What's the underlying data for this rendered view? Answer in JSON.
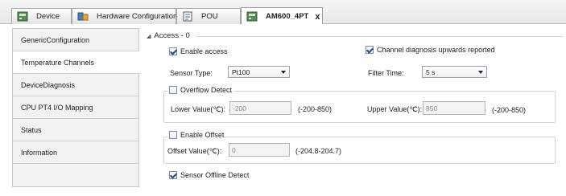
{
  "tabs": [
    {
      "label": "Device",
      "icon": "device-tab-icon"
    },
    {
      "label": "Hardware Configuration",
      "icon": "hardware-config-icon"
    },
    {
      "label": "POU",
      "icon": "pou-icon"
    },
    {
      "label": "AM600_4PT",
      "icon": "am600-tab-icon",
      "close": "x"
    }
  ],
  "nav": {
    "items": [
      {
        "label": "GenericConfiguration"
      },
      {
        "label": "Temperature Channels"
      },
      {
        "label": "DeviceDiagnosis"
      },
      {
        "label": "CPU PT4 I/O Mapping"
      },
      {
        "label": "Status"
      },
      {
        "label": "Information"
      }
    ],
    "selected_index": 1
  },
  "main": {
    "section_title": "Access - 0",
    "enable_access": {
      "label": "Enable access",
      "checked": true
    },
    "channel_diag": {
      "label": "Channel diagnosis upwards reported",
      "checked": true
    },
    "sensor_type": {
      "label": "Sensor Type:",
      "value": "Pt100"
    },
    "filter_time": {
      "label": "Filter Time:",
      "value": "5 s"
    },
    "overflow": {
      "label": "Overflow Detect",
      "checked": false,
      "lower_label": "Lower Value(℃):",
      "lower_value": "-200",
      "lower_range": "(-200-850)",
      "upper_label": "Upper Value(℃):",
      "upper_value": "850",
      "upper_range": "(-200-850)"
    },
    "offset": {
      "label": "Enable Offset",
      "checked": false,
      "offset_label": "Offset Value(℃):",
      "offset_value": "0",
      "offset_range": "(-204.8-204.7)"
    },
    "sensor_offline": {
      "label": "Sensor Offline Detect",
      "checked": true
    }
  }
}
